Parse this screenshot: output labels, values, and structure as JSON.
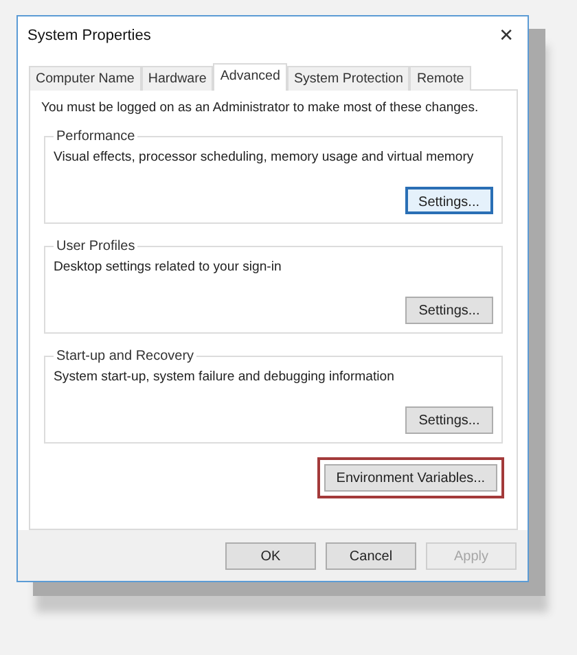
{
  "window": {
    "title": "System Properties",
    "close": "✕"
  },
  "tabs": [
    {
      "label": "Computer Name",
      "selected": false
    },
    {
      "label": "Hardware",
      "selected": false
    },
    {
      "label": "Advanced",
      "selected": true
    },
    {
      "label": "System Protection",
      "selected": false
    },
    {
      "label": "Remote",
      "selected": false
    }
  ],
  "notice": "You must be logged on as an Administrator to make most of these changes.",
  "groups": [
    {
      "title": "Performance",
      "description": "Visual effects, processor scheduling, memory usage and virtual memory",
      "button": {
        "label": "Settings...",
        "focused": true
      }
    },
    {
      "title": "User Profiles",
      "description": "Desktop settings related to your sign-in",
      "button": {
        "label": "Settings...",
        "focused": false
      }
    },
    {
      "title": "Start-up and Recovery",
      "description": "System start-up, system failure and debugging information",
      "button": {
        "label": "Settings...",
        "focused": false
      }
    }
  ],
  "environment_button": {
    "label": "Environment Variables...",
    "highlighted": true
  },
  "buttons": [
    {
      "label": "OK",
      "disabled": false
    },
    {
      "label": "Cancel",
      "disabled": false
    },
    {
      "label": "Apply",
      "disabled": true
    }
  ]
}
